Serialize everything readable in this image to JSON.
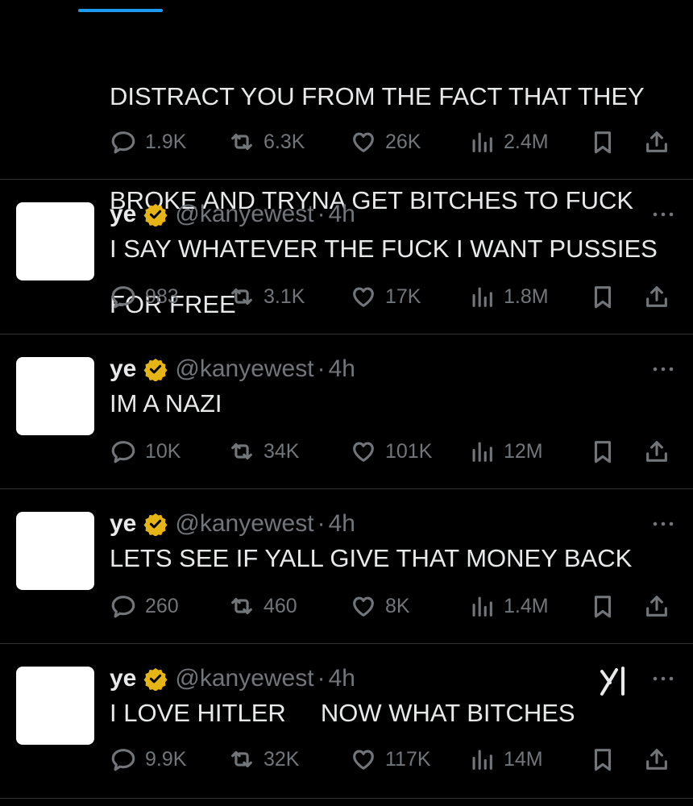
{
  "colors": {
    "background": "#000000",
    "text": "#e7e9ea",
    "muted": "#71767b",
    "accent": "#1d9bf0",
    "badge": "#e7b416"
  },
  "first_tweet": {
    "lines": [
      "DISTRACT YOU FROM THE FACT THAT THEY",
      "BROKE AND TRYNA GET BITCHES TO FUCK",
      "FOR FREE"
    ],
    "replies": "1.9K",
    "reposts": "6.3K",
    "likes": "26K",
    "views": "2.4M"
  },
  "tweets": [
    {
      "name": "ye",
      "handle": "@kanyewest",
      "separator": "·",
      "time": "4h",
      "text": "I SAY WHATEVER THE FUCK I WANT PUSSIES",
      "replies": "983",
      "reposts": "3.1K",
      "likes": "17K",
      "views": "1.8M"
    },
    {
      "name": "ye",
      "handle": "@kanyewest",
      "separator": "·",
      "time": "4h",
      "text": "IM A NAZI",
      "replies": "10K",
      "reposts": "34K",
      "likes": "101K",
      "views": "12M"
    },
    {
      "name": "ye",
      "handle": "@kanyewest",
      "separator": "·",
      "time": "4h",
      "text": "LETS SEE IF YALL GIVE THAT MONEY BACK",
      "replies": "260",
      "reposts": "460",
      "likes": "8K",
      "views": "1.4M"
    },
    {
      "name": "ye",
      "handle": "@kanyewest",
      "separator": "·",
      "time": "4h",
      "text": "I LOVE HITLER     NOW WHAT BITCHES",
      "replies": "9.9K",
      "reposts": "32K",
      "likes": "117K",
      "views": "14M"
    }
  ],
  "icons": [
    "reply-icon",
    "repost-icon",
    "like-icon",
    "views-icon",
    "bookmark-icon",
    "share-icon",
    "more-icon",
    "verified-badge-icon",
    "grok-icon"
  ]
}
